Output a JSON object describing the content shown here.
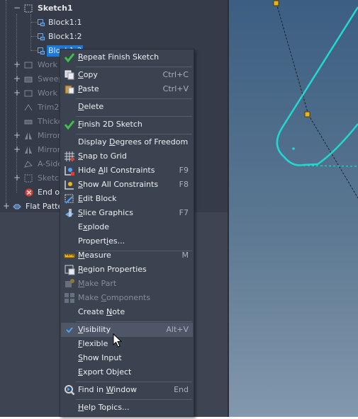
{
  "tree": {
    "items": [
      {
        "label": "Sketch1",
        "bold": true,
        "dim": false
      },
      {
        "label": "Block1:1",
        "dim": false
      },
      {
        "label": "Block1:2",
        "dim": false
      },
      {
        "label": "Block1:3",
        "dim": false,
        "selected": true
      },
      {
        "label": "Work Plane",
        "dim": true
      },
      {
        "label": "Sweep1",
        "dim": true
      },
      {
        "label": "Work Plane",
        "dim": true
      },
      {
        "label": "Trim2",
        "dim": true
      },
      {
        "label": "Thicken",
        "dim": true
      },
      {
        "label": "Mirror",
        "dim": true
      },
      {
        "label": "Mirror2",
        "dim": true
      },
      {
        "label": "A-Side",
        "dim": true
      },
      {
        "label": "Sketch",
        "dim": true
      },
      {
        "label": "End of Folded",
        "dim": false
      },
      {
        "label": "Flat Pattern",
        "dim": false
      }
    ]
  },
  "menu": {
    "items": [
      {
        "pre": "",
        "ul": "R",
        "post": "epeat Finish Sketch",
        "shortcut": ""
      },
      {
        "pre": "",
        "ul": "C",
        "post": "opy",
        "shortcut": "Ctrl+C"
      },
      {
        "pre": "",
        "ul": "P",
        "post": "aste",
        "shortcut": "Ctrl+V"
      },
      {
        "pre": "",
        "ul": "D",
        "post": "elete",
        "shortcut": ""
      },
      {
        "pre": "",
        "ul": "F",
        "post": "inish 2D Sketch",
        "shortcut": ""
      },
      {
        "pre": "Display ",
        "ul": "D",
        "post": "egrees of Freedom",
        "shortcut": ""
      },
      {
        "pre": "",
        "ul": "S",
        "post": "nap to Grid",
        "shortcut": ""
      },
      {
        "pre": "Hide ",
        "ul": "A",
        "post": "ll Constraints",
        "shortcut": "F9"
      },
      {
        "pre": "",
        "ul": "S",
        "post": "how All Constraints",
        "shortcut": "F8"
      },
      {
        "pre": "",
        "ul": "E",
        "post": "dit Block",
        "shortcut": ""
      },
      {
        "pre": "",
        "ul": "S",
        "post": "lice Graphics",
        "shortcut": "F7"
      },
      {
        "pre": "E",
        "ul": "x",
        "post": "plode",
        "shortcut": ""
      },
      {
        "pre": "Propert",
        "ul": "i",
        "post": "es...",
        "shortcut": ""
      },
      {
        "pre": "",
        "ul": "M",
        "post": "easure",
        "shortcut": "M"
      },
      {
        "pre": "",
        "ul": "R",
        "post": "egion Properties",
        "shortcut": ""
      },
      {
        "pre": "",
        "ul": "M",
        "post": "ake Part",
        "shortcut": "",
        "disabled": true
      },
      {
        "pre": "Make ",
        "ul": "C",
        "post": "omponents",
        "shortcut": "",
        "disabled": true
      },
      {
        "pre": "Create ",
        "ul": "N",
        "post": "ote",
        "shortcut": ""
      },
      {
        "pre": "",
        "ul": "V",
        "post": "isibility",
        "shortcut": "Alt+V",
        "checked": true
      },
      {
        "pre": "",
        "ul": "F",
        "post": "lexible",
        "shortcut": ""
      },
      {
        "pre": "",
        "ul": "S",
        "post": "how Input",
        "shortcut": ""
      },
      {
        "pre": "",
        "ul": "E",
        "post": "xport Object",
        "shortcut": ""
      },
      {
        "pre": "Find in ",
        "ul": "W",
        "post": "indow",
        "shortcut": "End"
      },
      {
        "pre": "",
        "ul": "H",
        "post": "elp Topics...",
        "shortcut": ""
      }
    ]
  },
  "colors": {
    "browser_bg": "#353b48",
    "menu_bg": "#3b4250",
    "check_green": "#3fc24c",
    "sketch_cyan": "#22d8cf",
    "constraint_yellow": "#e8b61c",
    "error_red": "#d9403a"
  },
  "icons": {
    "sketch": "sketch-icon",
    "block": "block-icon",
    "check": "checkmark-icon",
    "copy": "copy-icon",
    "paste": "paste-icon",
    "grid": "snap-grid-icon",
    "hide": "hide-constraints-icon",
    "show": "show-constraints-icon",
    "edit": "edit-block-icon",
    "slice": "slice-graphics-icon",
    "measure": "measure-icon",
    "region": "region-properties-icon",
    "find": "find-in-window-icon",
    "error": "error-icon",
    "flat": "flat-pattern-icon"
  }
}
